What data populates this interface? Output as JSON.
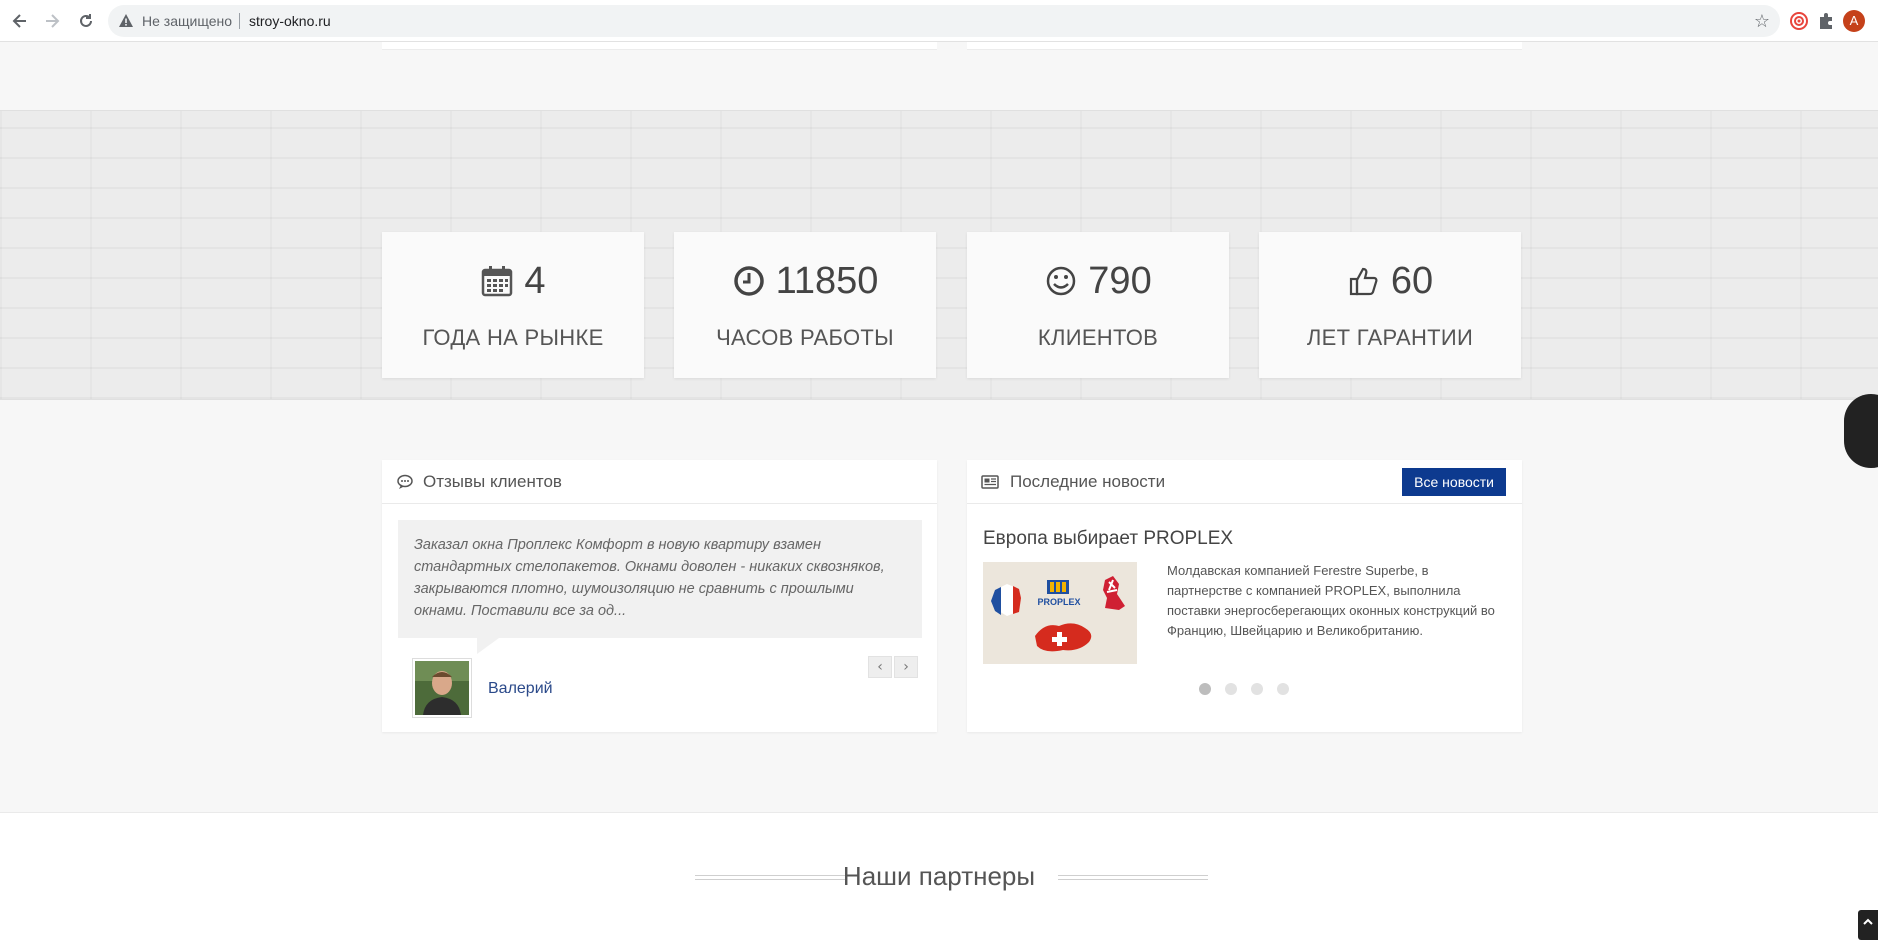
{
  "browser": {
    "back_icon": "arrow-left-icon",
    "forward_icon": "arrow-right-icon",
    "reload_icon": "reload-icon",
    "security_label": "Не защищено",
    "url": "stroy-okno.ru",
    "profile_initial": "A"
  },
  "stats": [
    {
      "icon": "calendar-icon",
      "value": "4",
      "label": "ГОДА НА РЫНКЕ"
    },
    {
      "icon": "clock-icon",
      "value": "11850",
      "label": "ЧАСОВ РАБОТЫ"
    },
    {
      "icon": "smile-icon",
      "value": "790",
      "label": "КЛИЕНТОВ"
    },
    {
      "icon": "thumbs-up-icon",
      "value": "60",
      "label": "ЛЕТ ГАРАНТИИ"
    }
  ],
  "reviews": {
    "title": "Отзывы клиентов",
    "text": "Заказал окна Проплекс Комфорт в новую квартиру взамен стандартных стелопакетов. Окнами доволен - никаких сквозняков, закрываются плотно, шумоизоляцию не сравнить с прошлыми окнами. Поставили все за од...",
    "author": "Валерий",
    "prev_label": "‹",
    "next_label": "›"
  },
  "news": {
    "title": "Последние новости",
    "all_news_label": "Все новости",
    "item_title": "Европа выбирает PROPLEX",
    "item_text": "Молдавская компанией Ferestre Superbe, в партнерстве с компанией PROPLEX, выполнила поставки энергосберегающих оконных конструкций во Францию, Швейцарию и Великобританию.",
    "image_logo_text": "PROPLEX",
    "slides": 4,
    "active_slide": 1
  },
  "partners": {
    "title": "Наши партнеры"
  },
  "colors": {
    "accent": "#0d3a8f",
    "author_link": "#2b4a8a",
    "stats_bg": "#ececec"
  }
}
